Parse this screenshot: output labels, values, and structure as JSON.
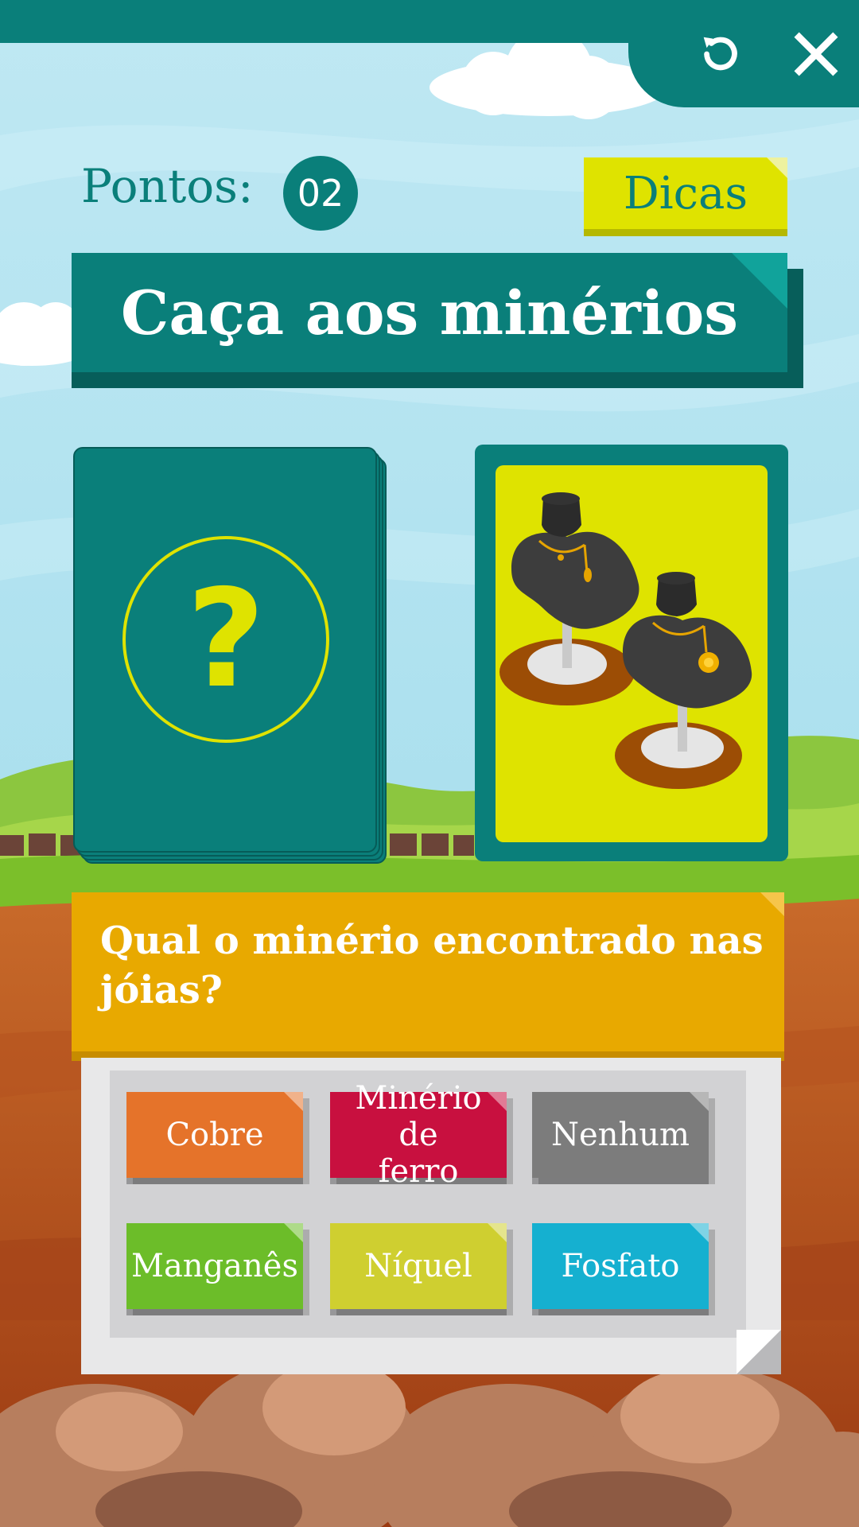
{
  "score": {
    "label": "Pontos:",
    "value": "02"
  },
  "tips": {
    "label": "Dicas"
  },
  "title": "Caça aos minérios",
  "question": "Qual o minério encontrado nas jóias?",
  "answers": [
    {
      "label": "Cobre",
      "color": "#e5732a"
    },
    {
      "label": "Minério de ferro",
      "color": "#c8103f"
    },
    {
      "label": "Nenhum",
      "color": "#7c7c7c"
    },
    {
      "label": "Manganês",
      "color": "#6cbd29"
    },
    {
      "label": "Níquel",
      "color": "#cfcf30"
    },
    {
      "label": "Fosfato",
      "color": "#15b0d0"
    }
  ],
  "icons": {
    "restart": "restart-icon",
    "close": "close-icon",
    "mystery": "question-mark-icon"
  },
  "colors": {
    "teal": "#0a7f7a",
    "yellow": "#dfe300",
    "orange": "#e8a900"
  },
  "mystery_symbol": "?"
}
